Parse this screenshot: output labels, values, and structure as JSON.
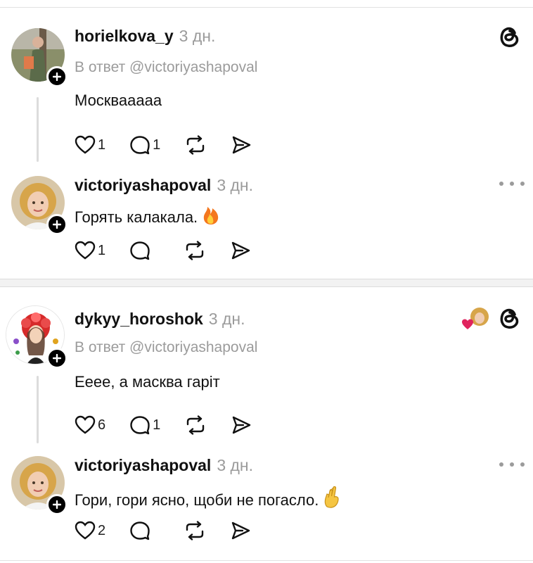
{
  "posts": [
    {
      "username": "horielkova_y",
      "time": "3 дн.",
      "reply_to": "В ответ @victoriyashapoval",
      "text": "Москвааааа",
      "likes": "1",
      "comments": "1"
    },
    {
      "username": "victoriyashapoval",
      "time": "3 дн.",
      "text": "Горять калакала.",
      "emoji": "fire-icon",
      "likes": "1",
      "comments": ""
    },
    {
      "username": "dykyy_horoshok",
      "time": "3 дн.",
      "reply_to": "В ответ @victoriyashapoval",
      "text": "Еeee, а масква гаріт",
      "likes": "6",
      "comments": "1"
    },
    {
      "username": "victoriyashapoval",
      "time": "3 дн.",
      "text": "Гори, гори ясно, щоби не погасло.",
      "emoji": "crossed-fingers-icon",
      "likes": "2",
      "comments": ""
    }
  ],
  "colors": {
    "text": "#111111",
    "muted": "#9b9b9b",
    "heart_red": "#e0245e"
  }
}
